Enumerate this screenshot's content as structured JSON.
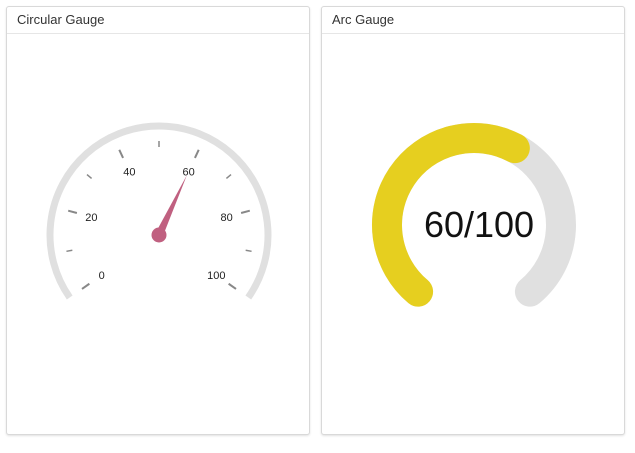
{
  "circular_gauge": {
    "title": "Circular Gauge",
    "value": 60,
    "min": 0,
    "max": 100,
    "tick_labels": [
      "0",
      "20",
      "40",
      "60",
      "80",
      "100"
    ],
    "colors": {
      "track": "#e0e0e0",
      "tick": "#888888",
      "needle": "#c06080",
      "label": "#222222"
    }
  },
  "arc_gauge": {
    "title": "Arc Gauge",
    "value": 60,
    "max": 100,
    "value_text": "60/100",
    "colors": {
      "filled": "#e6cf1f",
      "track": "#e0e0e0",
      "text": "#111111"
    }
  }
}
